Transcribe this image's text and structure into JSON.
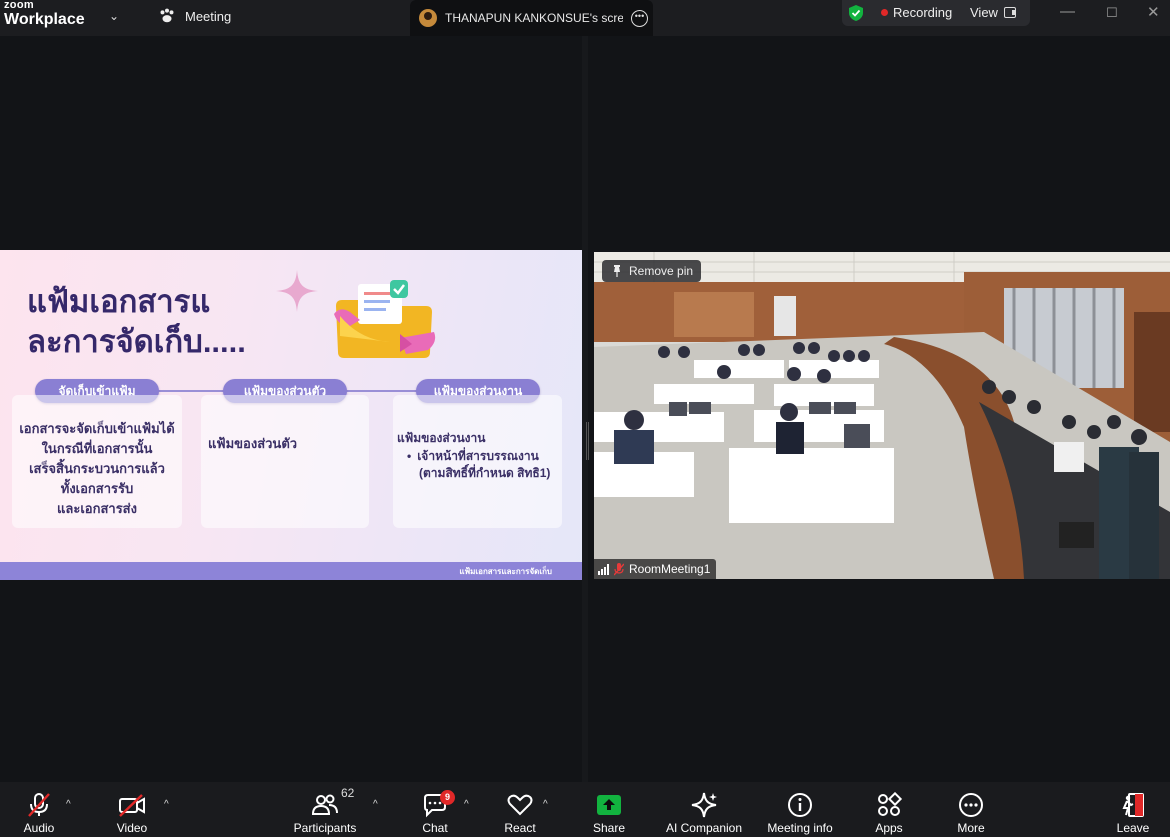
{
  "window": {
    "brand_top": "zoom",
    "brand_bottom": "Workplace",
    "meeting_tab": "Meeting",
    "share_tab": "THANAPUN KANKONSUE's screen",
    "recording": "Recording",
    "view": "View"
  },
  "slide": {
    "title_line1": "แฟ้มเอกสารแ",
    "title_line2": "ละการจัดเก็บ.....",
    "pills": [
      "จัดเก็บเข้าแฟ้ม",
      "แฟ้มของส่วนตัว",
      "แฟ้มของส่วนงาน"
    ],
    "card1": [
      "เอกสารจะจัดเก็บเข้าแฟ้มได้",
      "ในกรณีที่เอกสารนั้น",
      "เสร็จสิ้นกระบวนการแล้ว",
      "ทั้งเอกสารรับ",
      "และเอกสารส่ง"
    ],
    "card2": "แฟ้มของส่วนตัว",
    "card3_title": "แฟ้มของส่วนงาน",
    "card3_bullet1": "เจ้าหน้าที่สารบรรณงาน",
    "card3_bullet2": "(ตามสิทธิ์ที่กำหนด สิทธิ1)",
    "footer": "แฟ้มเอกสารและการจัดเก็บ"
  },
  "video": {
    "pin_label": "Remove pin",
    "participant_name": "RoomMeeting1"
  },
  "toolbar": {
    "audio": "Audio",
    "video": "Video",
    "participants": "Participants",
    "participants_count": "62",
    "chat": "Chat",
    "chat_badge": "9",
    "react": "React",
    "share": "Share",
    "ai_companion": "AI Companion",
    "meeting_info": "Meeting info",
    "apps": "Apps",
    "more": "More",
    "leave": "Leave"
  },
  "colors": {
    "accent_green": "#12b33f",
    "recording_red": "#e02828",
    "slide_title": "#35286a",
    "pill": "#8a7fd3"
  }
}
